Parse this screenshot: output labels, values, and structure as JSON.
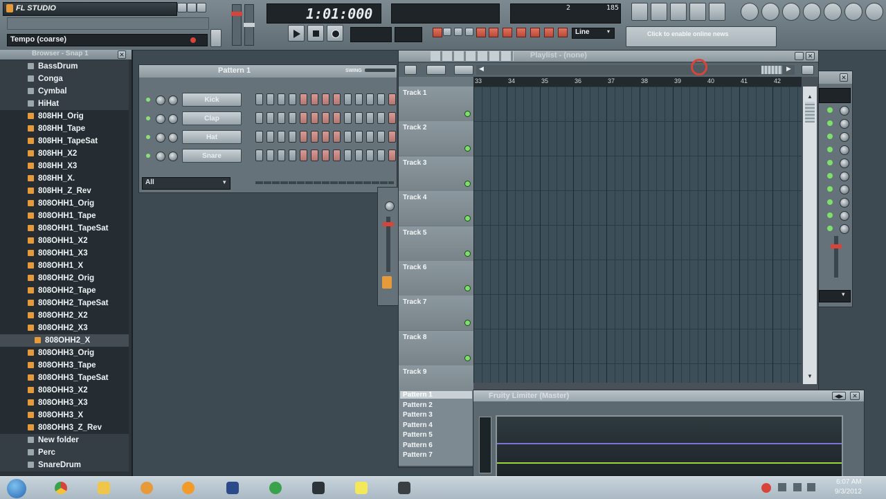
{
  "app": {
    "name": "FL STUDIO"
  },
  "hint": {
    "label": "Tempo (coarse)"
  },
  "transport": {
    "time": "1:01:000",
    "snap": "Line",
    "news": "Click to enable online news",
    "tempo_value": "185",
    "pattern_num": "2"
  },
  "browser": {
    "title": "Browser - Snap 1",
    "items": [
      {
        "label": "BassDrum",
        "kind": "folder"
      },
      {
        "label": "Conga",
        "kind": "folder"
      },
      {
        "label": "Cymbal",
        "kind": "folder"
      },
      {
        "label": "HiHat",
        "kind": "folder"
      },
      {
        "label": "808HH_Orig",
        "kind": "file"
      },
      {
        "label": "808HH_Tape",
        "kind": "file"
      },
      {
        "label": "808HH_TapeSat",
        "kind": "file"
      },
      {
        "label": "808HH_X2",
        "kind": "file"
      },
      {
        "label": "808HH_X3",
        "kind": "file"
      },
      {
        "label": "808HH_X.",
        "kind": "file"
      },
      {
        "label": "808HH_Z_Rev",
        "kind": "file"
      },
      {
        "label": "808OHH1_Orig",
        "kind": "file"
      },
      {
        "label": "808OHH1_Tape",
        "kind": "file"
      },
      {
        "label": "808OHH1_TapeSat",
        "kind": "file"
      },
      {
        "label": "808OHH1_X2",
        "kind": "file"
      },
      {
        "label": "808OHH1_X3",
        "kind": "file"
      },
      {
        "label": "808OHH1_X",
        "kind": "file"
      },
      {
        "label": "808OHH2_Orig",
        "kind": "file"
      },
      {
        "label": "808OHH2_Tape",
        "kind": "file"
      },
      {
        "label": "808OHH2_TapeSat",
        "kind": "file"
      },
      {
        "label": "808OHH2_X2",
        "kind": "file"
      },
      {
        "label": "808OHH2_X3",
        "kind": "file"
      },
      {
        "label": "808OHH2_X",
        "kind": "selected"
      },
      {
        "label": "808OHH3_Orig",
        "kind": "file"
      },
      {
        "label": "808OHH3_Tape",
        "kind": "file"
      },
      {
        "label": "808OHH3_TapeSat",
        "kind": "file"
      },
      {
        "label": "808OHH3_X2",
        "kind": "file"
      },
      {
        "label": "808OHH3_X3",
        "kind": "file"
      },
      {
        "label": "808OHH3_X",
        "kind": "file"
      },
      {
        "label": "808OHH3_Z_Rev",
        "kind": "file"
      },
      {
        "label": "New folder",
        "kind": "folder"
      },
      {
        "label": "Perc",
        "kind": "folder"
      },
      {
        "label": "SnareDrum",
        "kind": "folder"
      }
    ]
  },
  "step_sequencer": {
    "title": "Pattern 1",
    "swing_label": "SWING",
    "filter": "All",
    "channels": [
      {
        "name": "Kick"
      },
      {
        "name": "Clap"
      },
      {
        "name": "Hat"
      },
      {
        "name": "Snare"
      }
    ]
  },
  "playlist": {
    "title": "Playlist - (none)",
    "ruler": [
      "33",
      "34",
      "35",
      "36",
      "37",
      "38",
      "39",
      "40",
      "41",
      "42"
    ],
    "tracks": [
      "Track 1",
      "Track 2",
      "Track 3",
      "Track 4",
      "Track 5",
      "Track 6",
      "Track 7",
      "Track 8",
      "Track 9"
    ],
    "patterns": [
      "Pattern 1",
      "Pattern 2",
      "Pattern 3",
      "Pattern 4",
      "Pattern 5",
      "Pattern 6",
      "Pattern 7"
    ]
  },
  "limiter": {
    "title": "Fruity Limiter (Master)"
  },
  "taskbar": {
    "time": "6:07 AM",
    "date": "9/3/2012"
  },
  "colors": {
    "accent_red": "#d9443a",
    "led_green": "#7de06a",
    "limiter_line_purple": "#7b74d6",
    "limiter_line_green": "#9ad83a"
  }
}
